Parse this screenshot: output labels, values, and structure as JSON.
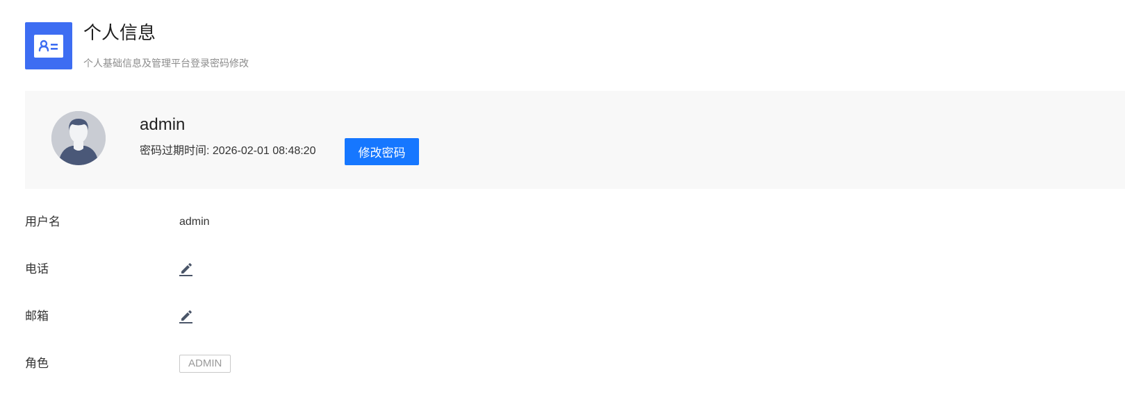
{
  "header": {
    "icon": "id-card-icon",
    "title": "个人信息",
    "subtitle": "个人基础信息及管理平台登录密码修改"
  },
  "profile": {
    "avatar_icon": "user-avatar-icon",
    "username": "admin",
    "password_expiry_label": "密码过期时间:",
    "password_expiry_value": "2026-02-01 08:48:20",
    "change_password_label": "修改密码"
  },
  "fields": {
    "username_label": "用户名",
    "username_value": "admin",
    "phone_label": "电话",
    "email_label": "邮箱",
    "role_label": "角色",
    "role_value": "ADMIN"
  },
  "colors": {
    "accent": "#3d6df2",
    "button": "#1677ff",
    "panel_bg": "#f8f8f8",
    "edit_icon": "#4a5568"
  }
}
